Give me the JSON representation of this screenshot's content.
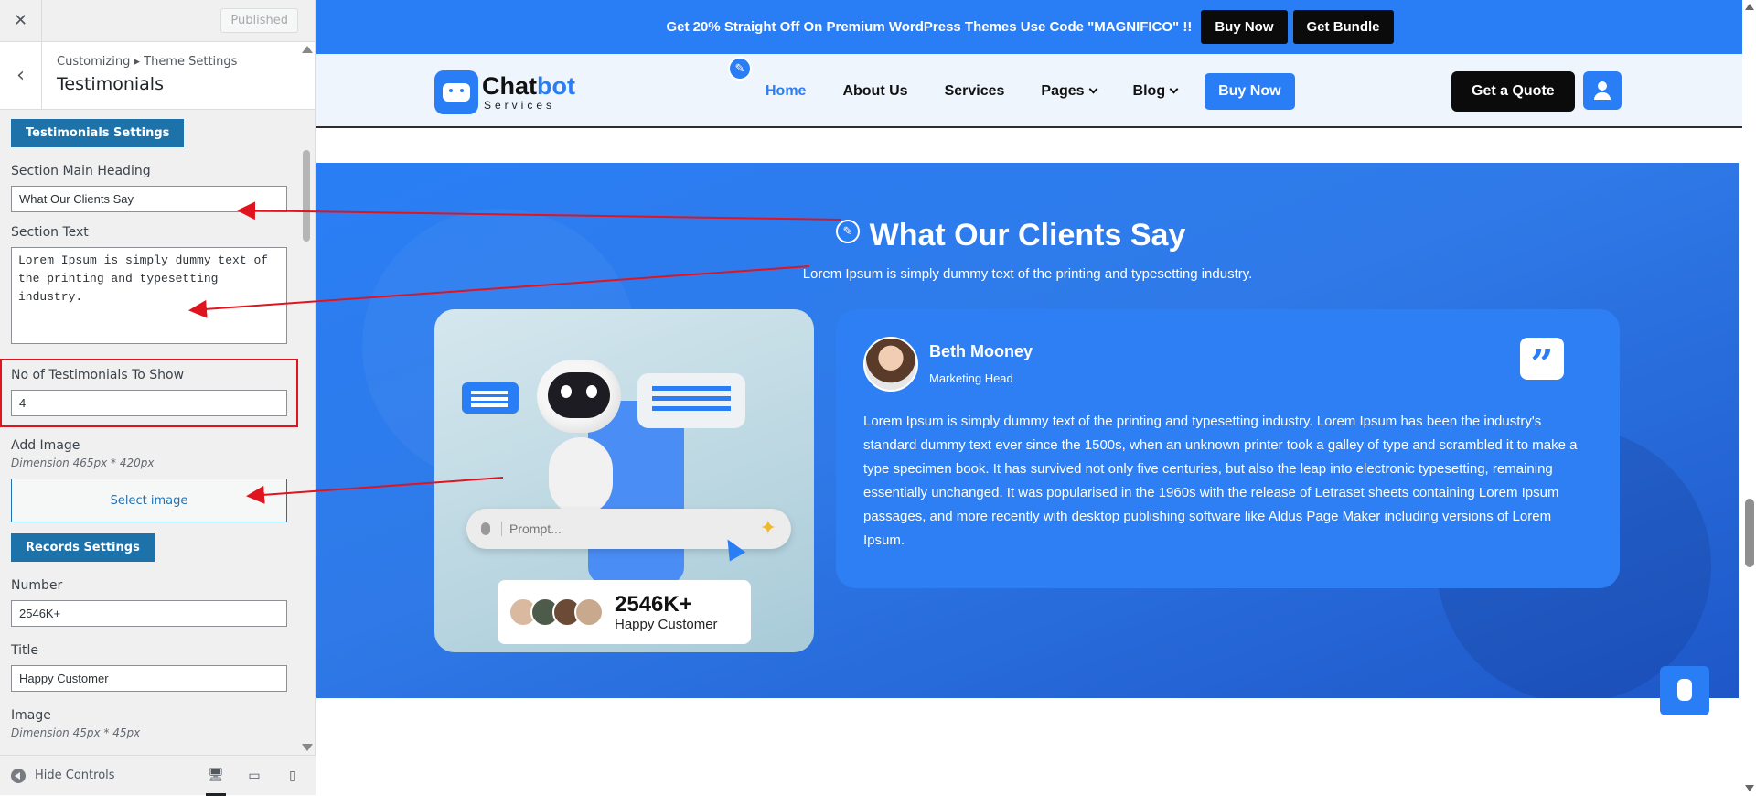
{
  "customizer": {
    "close_icon": "close-icon",
    "publish_label": "Published",
    "breadcrumb": "Customizing ▸ Theme Settings",
    "section_title": "Testimonials",
    "testimonials_settings_label": "Testimonials Settings",
    "main_heading_label": "Section Main Heading",
    "main_heading_value": "What Our Clients Say",
    "section_text_label": "Section Text",
    "section_text_value": "Lorem Ipsum is simply dummy text of the printing and typesetting industry.",
    "no_testimonials_label": "No of Testimonials To Show",
    "no_testimonials_value": "4",
    "add_image_label": "Add Image",
    "add_image_hint": "Dimension 465px * 420px",
    "select_image_label": "Select image",
    "records_settings_label": "Records Settings",
    "number_label": "Number",
    "number_value": "2546K+",
    "title_label": "Title",
    "title_value": "Happy Customer",
    "image_label": "Image",
    "image_hint": "Dimension 45px * 45px",
    "hide_controls_label": "Hide Controls",
    "devices": [
      "desktop-icon",
      "tablet-icon",
      "mobile-icon"
    ]
  },
  "preview": {
    "promo_text": "Get 20% Straight Off On Premium WordPress Themes Use Code \"MAGNIFICO\" !!",
    "promo_buy": "Buy Now",
    "promo_bundle": "Get Bundle",
    "logo_main": "Chat",
    "logo_accent": "bot",
    "logo_sub": "Services",
    "menu": [
      {
        "label": "Home",
        "active": true
      },
      {
        "label": "About Us"
      },
      {
        "label": "Services"
      },
      {
        "label": "Pages",
        "dropdown": true
      },
      {
        "label": "Blog",
        "dropdown": true
      }
    ],
    "menu_buy": "Buy Now",
    "quote_btn": "Get a Quote",
    "section_title": "What Our Clients Say",
    "section_text": "Lorem Ipsum is simply dummy text of the printing and typesetting industry.",
    "prompt_placeholder": "Prompt...",
    "stat_number": "2546K+",
    "stat_label": "Happy Customer",
    "testimonial": {
      "name": "Beth Mooney",
      "role": "Marketing Head",
      "quote_icon": "quote-icon",
      "body": "Lorem Ipsum is simply dummy text of the printing and typesetting industry. Lorem Ipsum has been the industry's standard dummy text ever since the 1500s, when an unknown printer took a galley of type and scrambled it to make a type specimen book. It has survived not only five centuries, but also the leap into electronic typesetting, remaining essentially unchanged. It was popularised in the 1960s with the release of Letraset sheets containing Lorem Ipsum passages, and more recently with desktop publishing software like Aldus Page Maker including versions of Lorem Ipsum."
    }
  },
  "colors": {
    "accent": "#2a7ef5",
    "annotation": "#e0141f",
    "customizer_button": "#1d72aa"
  }
}
